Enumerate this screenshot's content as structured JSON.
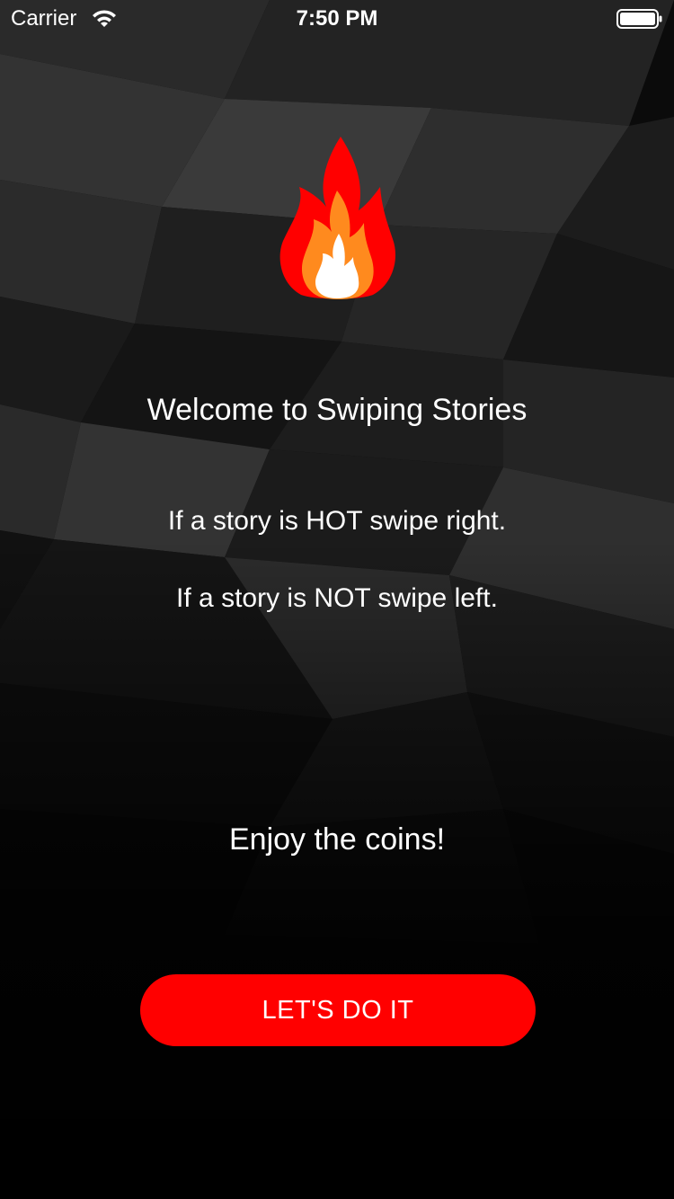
{
  "status_bar": {
    "carrier": "Carrier",
    "time": "7:50 PM",
    "wifi_icon": "wifi-icon",
    "battery_icon": "battery-full-icon"
  },
  "hero": {
    "icon": "flame-icon",
    "flame_colors": [
      "#ff0000",
      "#ff8a1e",
      "#ffffff"
    ]
  },
  "content": {
    "welcome": "Welcome to Swiping Stories",
    "rule_hot": "If a story is HOT swipe right.",
    "rule_not": "If a story is NOT swipe left.",
    "coins": "Enjoy the coins!"
  },
  "cta": {
    "label": "LET'S DO IT",
    "color": "#ff0000"
  },
  "theme": {
    "background": "#000000",
    "text": "#ffffff"
  }
}
